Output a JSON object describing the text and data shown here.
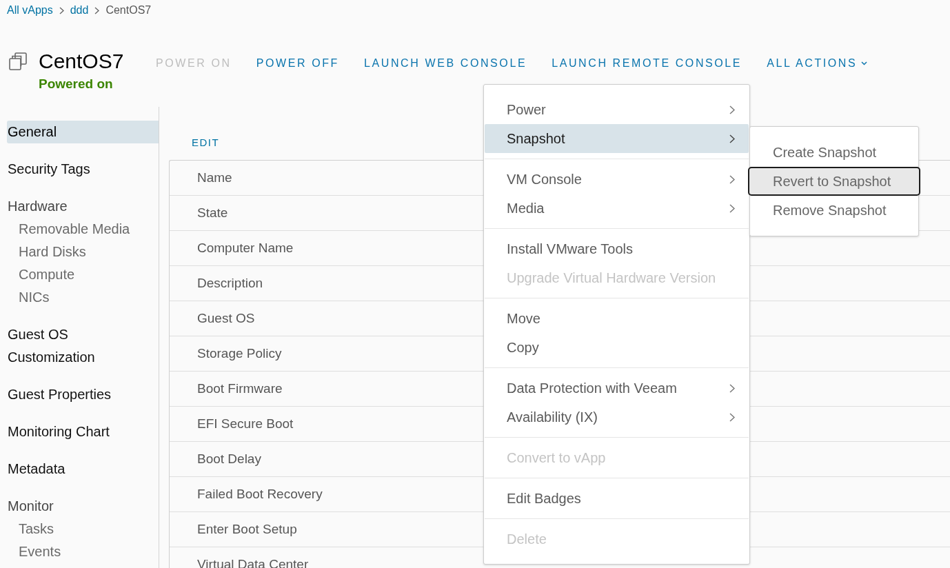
{
  "breadcrumb": [
    {
      "label": "All vApps",
      "kind": "link"
    },
    {
      "label": "ddd",
      "kind": "link"
    },
    {
      "label": "CentOS7",
      "kind": "current"
    }
  ],
  "header": {
    "title": "CentOS7",
    "status": "Powered on",
    "actions": [
      {
        "label": "POWER ON",
        "kind": "action",
        "disabled": true
      },
      {
        "label": "POWER OFF",
        "kind": "action",
        "disabled": false
      },
      {
        "label": "LAUNCH WEB CONSOLE",
        "kind": "action",
        "disabled": false
      },
      {
        "label": "LAUNCH REMOTE CONSOLE",
        "kind": "action",
        "disabled": false
      },
      {
        "label": "ALL ACTIONS",
        "kind": "dropdown",
        "disabled": false
      }
    ]
  },
  "sidebar": {
    "items": [
      {
        "label": "General",
        "selected": true
      },
      {
        "label": "Security Tags",
        "selected": false
      },
      {
        "label": "Hardware",
        "selected": false,
        "children": [
          {
            "label": "Removable Media",
            "selected": false
          },
          {
            "label": "Hard Disks",
            "selected": false
          },
          {
            "label": "Compute",
            "selected": false
          },
          {
            "label": "NICs",
            "selected": false
          }
        ]
      },
      {
        "label": "Guest OS Customization",
        "selected": false
      },
      {
        "label": "Guest Properties",
        "selected": false
      },
      {
        "label": "Monitoring Chart",
        "selected": false
      },
      {
        "label": "Metadata",
        "selected": false
      },
      {
        "label": "Monitor",
        "selected": false,
        "children": [
          {
            "label": "Tasks",
            "selected": false
          },
          {
            "label": "Events",
            "selected": false
          }
        ]
      }
    ]
  },
  "details": {
    "edit_label": "EDIT",
    "rows": [
      {
        "label": "Name"
      },
      {
        "label": "State"
      },
      {
        "label": "Computer Name"
      },
      {
        "label": "Description"
      },
      {
        "label": "Guest OS"
      },
      {
        "label": "Storage Policy"
      },
      {
        "label": "Boot Firmware"
      },
      {
        "label": "EFI Secure Boot"
      },
      {
        "label": "Boot Delay"
      },
      {
        "label": "Failed Boot Recovery"
      },
      {
        "label": "Enter Boot Setup"
      },
      {
        "label": "Virtual Data Center"
      }
    ]
  },
  "actions_menu": {
    "sections": [
      {
        "items": [
          {
            "label": "Power",
            "kind": "submenu",
            "selected": false,
            "disabled": false
          },
          {
            "label": "Snapshot",
            "kind": "submenu",
            "selected": true,
            "disabled": false,
            "children": [
              {
                "label": "Create Snapshot",
                "selected": false
              },
              {
                "label": "Revert to Snapshot",
                "selected": true
              },
              {
                "label": "Remove Snapshot",
                "selected": false
              }
            ]
          }
        ]
      },
      {
        "items": [
          {
            "label": "VM Console",
            "kind": "submenu",
            "selected": false,
            "disabled": false
          },
          {
            "label": "Media",
            "kind": "submenu",
            "selected": false,
            "disabled": false
          }
        ]
      },
      {
        "items": [
          {
            "label": "Install VMware Tools",
            "kind": "action",
            "selected": false,
            "disabled": false
          },
          {
            "label": "Upgrade Virtual Hardware Version",
            "kind": "action",
            "selected": false,
            "disabled": true
          }
        ]
      },
      {
        "items": [
          {
            "label": "Move",
            "kind": "action",
            "selected": false,
            "disabled": false
          },
          {
            "label": "Copy",
            "kind": "action",
            "selected": false,
            "disabled": false
          }
        ]
      },
      {
        "items": [
          {
            "label": "Data Protection with Veeam",
            "kind": "submenu",
            "selected": false,
            "disabled": false
          },
          {
            "label": "Availability (IX)",
            "kind": "submenu",
            "selected": false,
            "disabled": false
          }
        ]
      },
      {
        "items": [
          {
            "label": "Convert to vApp",
            "kind": "action",
            "selected": false,
            "disabled": true
          }
        ]
      },
      {
        "items": [
          {
            "label": "Edit Badges",
            "kind": "action",
            "selected": false,
            "disabled": false
          }
        ]
      },
      {
        "items": [
          {
            "label": "Delete",
            "kind": "action",
            "selected": false,
            "disabled": true
          }
        ]
      }
    ]
  }
}
